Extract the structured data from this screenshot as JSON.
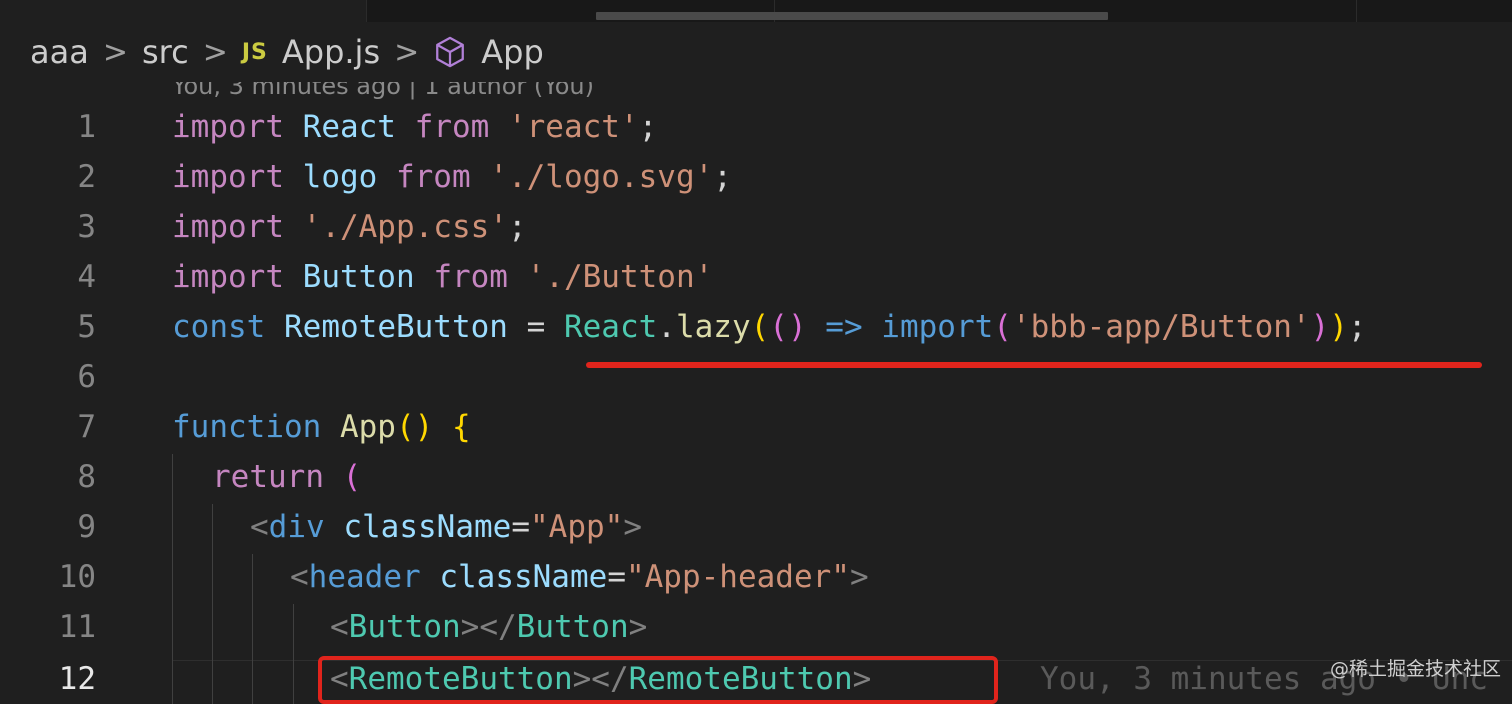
{
  "breadcrumb": {
    "items": [
      "aaa",
      "src",
      "App.js",
      "App"
    ],
    "file_badge": "JS",
    "separator": ">"
  },
  "codelens": "You, 3 minutes ago | 1 author (You)",
  "lines": [
    {
      "n": "1"
    },
    {
      "n": "2"
    },
    {
      "n": "3"
    },
    {
      "n": "4"
    },
    {
      "n": "5"
    },
    {
      "n": "6"
    },
    {
      "n": "7"
    },
    {
      "n": "8"
    },
    {
      "n": "9"
    },
    {
      "n": "10"
    },
    {
      "n": "11"
    },
    {
      "n": "12"
    }
  ],
  "code": {
    "l1": {
      "t0": "import",
      "t1": " ",
      "t2": "React",
      "t3": " ",
      "t4": "from",
      "t5": " ",
      "t6": "'react'",
      "t7": ";"
    },
    "l2": {
      "t0": "import",
      "t1": " ",
      "t2": "logo",
      "t3": " ",
      "t4": "from",
      "t5": " ",
      "t6": "'./logo.svg'",
      "t7": ";"
    },
    "l3": {
      "t0": "import",
      "t1": " ",
      "t2": "'./App.css'",
      "t3": ";"
    },
    "l4": {
      "t0": "import",
      "t1": " ",
      "t2": "Button",
      "t3": " ",
      "t4": "from",
      "t5": " ",
      "t6": "'./Button'"
    },
    "l5": {
      "t0": "const",
      "t1": " ",
      "t2": "RemoteButton",
      "t3": " = ",
      "t4": "React",
      "t5": ".",
      "t6": "lazy",
      "t7": "(",
      "t8": "()",
      "t9": " ",
      "t10": "=>",
      "t11": " ",
      "t12": "import",
      "t13": "(",
      "t14": "'bbb-app/Button'",
      "t15": ")",
      "t16": ")",
      "t17": ";"
    },
    "l7": {
      "t0": "function",
      "t1": " ",
      "t2": "App",
      "t3": "()",
      "t4": " ",
      "t5": "{"
    },
    "l8": {
      "t0": "return",
      "t1": " ",
      "t2": "("
    },
    "l9": {
      "t0": "<",
      "t1": "div",
      "t2": " ",
      "t3": "className",
      "t4": "=",
      "t5": "\"App\"",
      "t6": ">"
    },
    "l10": {
      "t0": "<",
      "t1": "header",
      "t2": " ",
      "t3": "className",
      "t4": "=",
      "t5": "\"App-header\"",
      "t6": ">"
    },
    "l11": {
      "t0": "<",
      "t1": "Button",
      "t2": "></",
      "t3": "Button",
      "t4": ">"
    },
    "l12": {
      "t0": "<",
      "t1": "RemoteButton",
      "t2": "></",
      "t3": "RemoteButton",
      "t4": ">"
    }
  },
  "blame": "You, 3 minutes ago • Unc",
  "watermark": "@稀土掘金技术社区",
  "colors": {
    "annotation": "#e0241c",
    "background": "#1f1f1f",
    "keyword": "#c586c0",
    "string": "#ce9178",
    "type": "#4ec9b0",
    "variable": "#9cdcfe"
  }
}
